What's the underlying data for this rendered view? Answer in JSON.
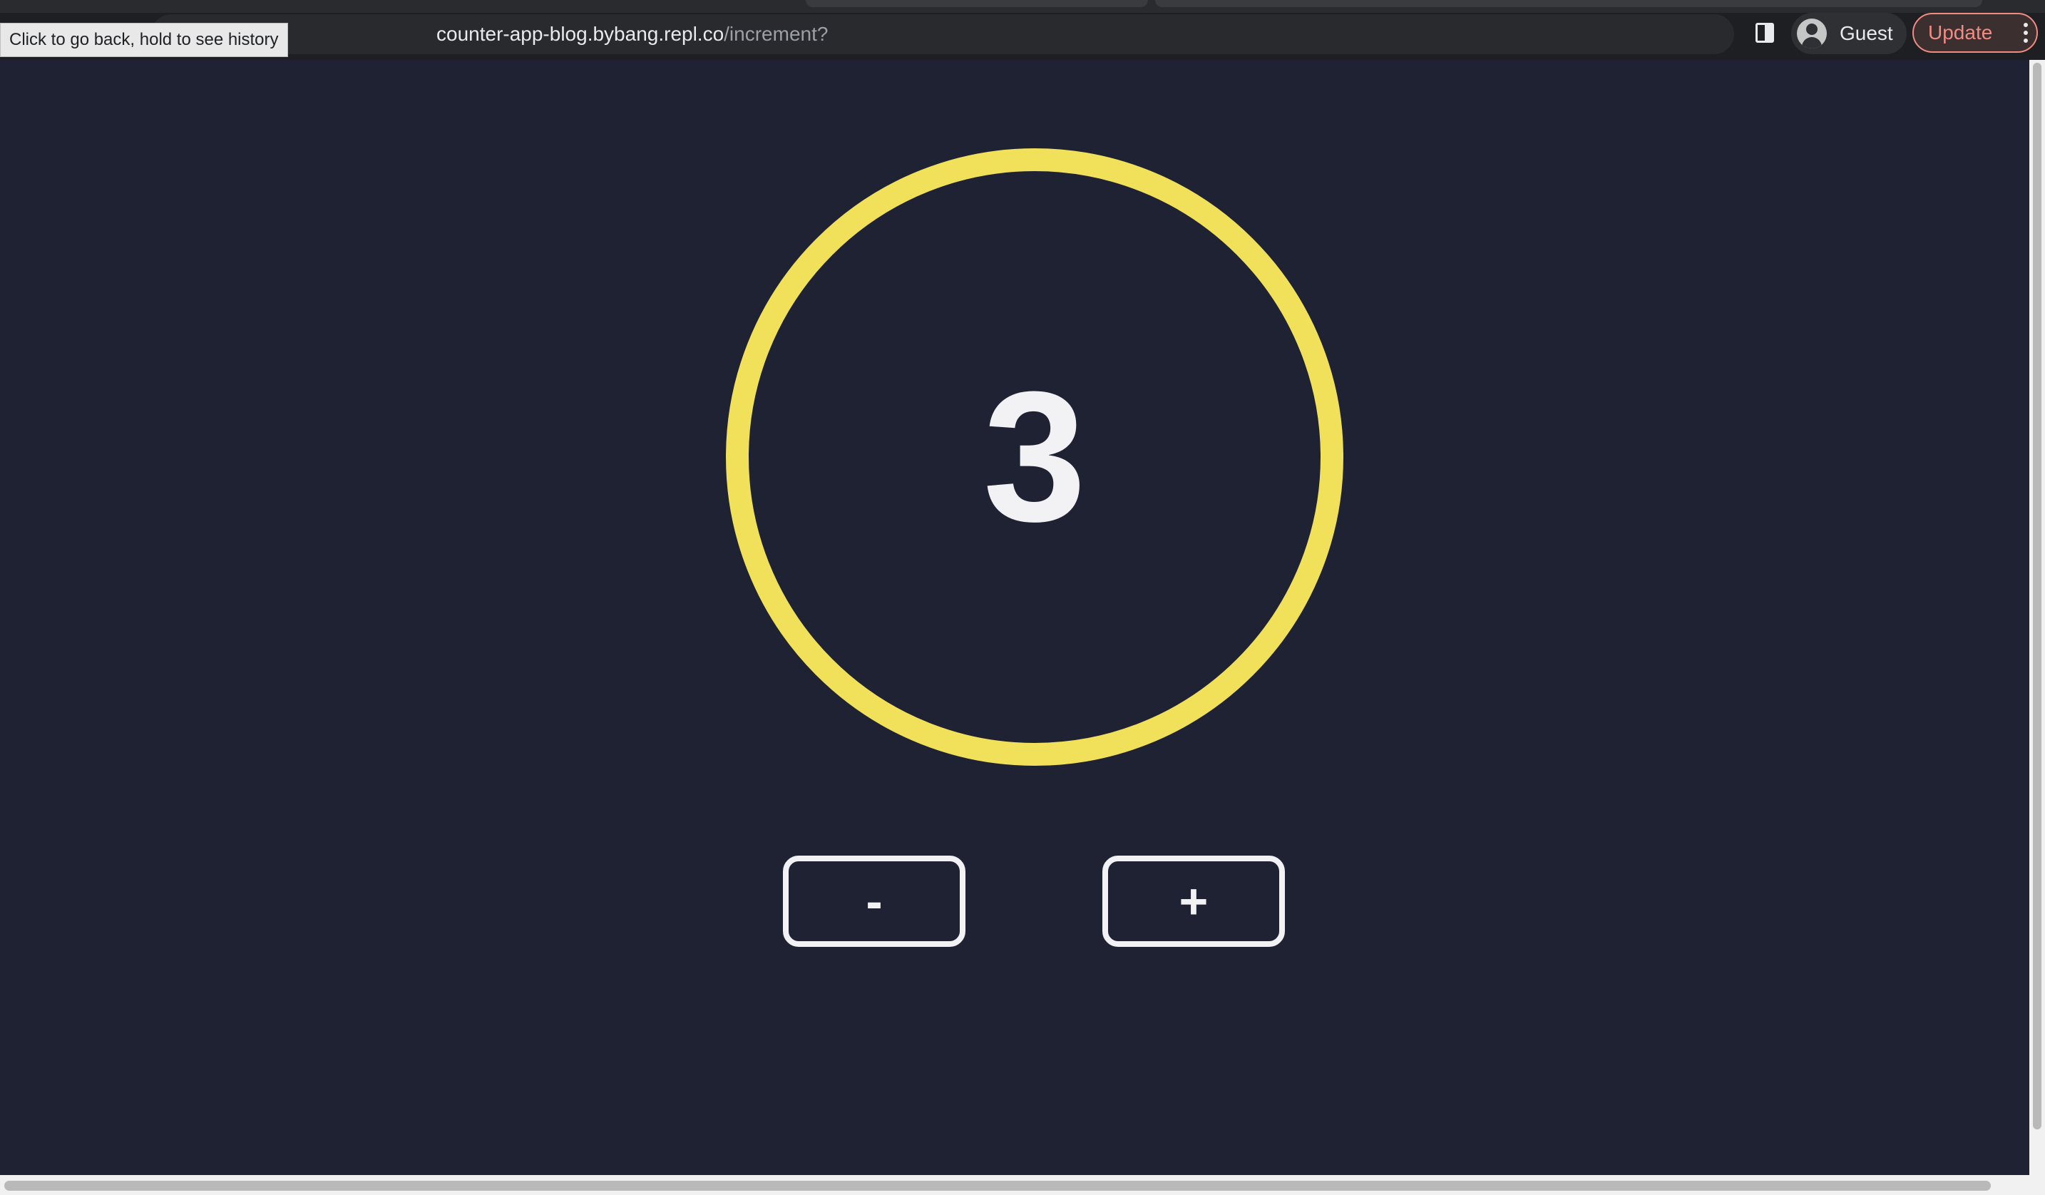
{
  "browser": {
    "url_host": "counter-app-blog.bybang.repl.co",
    "url_path": "/increment?",
    "back_tooltip": "Click to go back, hold to see history",
    "profile_label": "Guest",
    "update_label": "Update"
  },
  "counter": {
    "value": "3",
    "decrement_label": "-",
    "increment_label": "+"
  },
  "colors": {
    "background": "#1f2233",
    "ring": "#f1e05a",
    "foreground": "#f2f2f4",
    "update_accent": "#f28b82"
  },
  "icons": [
    "back-arrow-icon",
    "forward-arrow-icon",
    "reload-icon",
    "side-panel-icon",
    "profile-avatar-icon",
    "more-menu-icon"
  ]
}
